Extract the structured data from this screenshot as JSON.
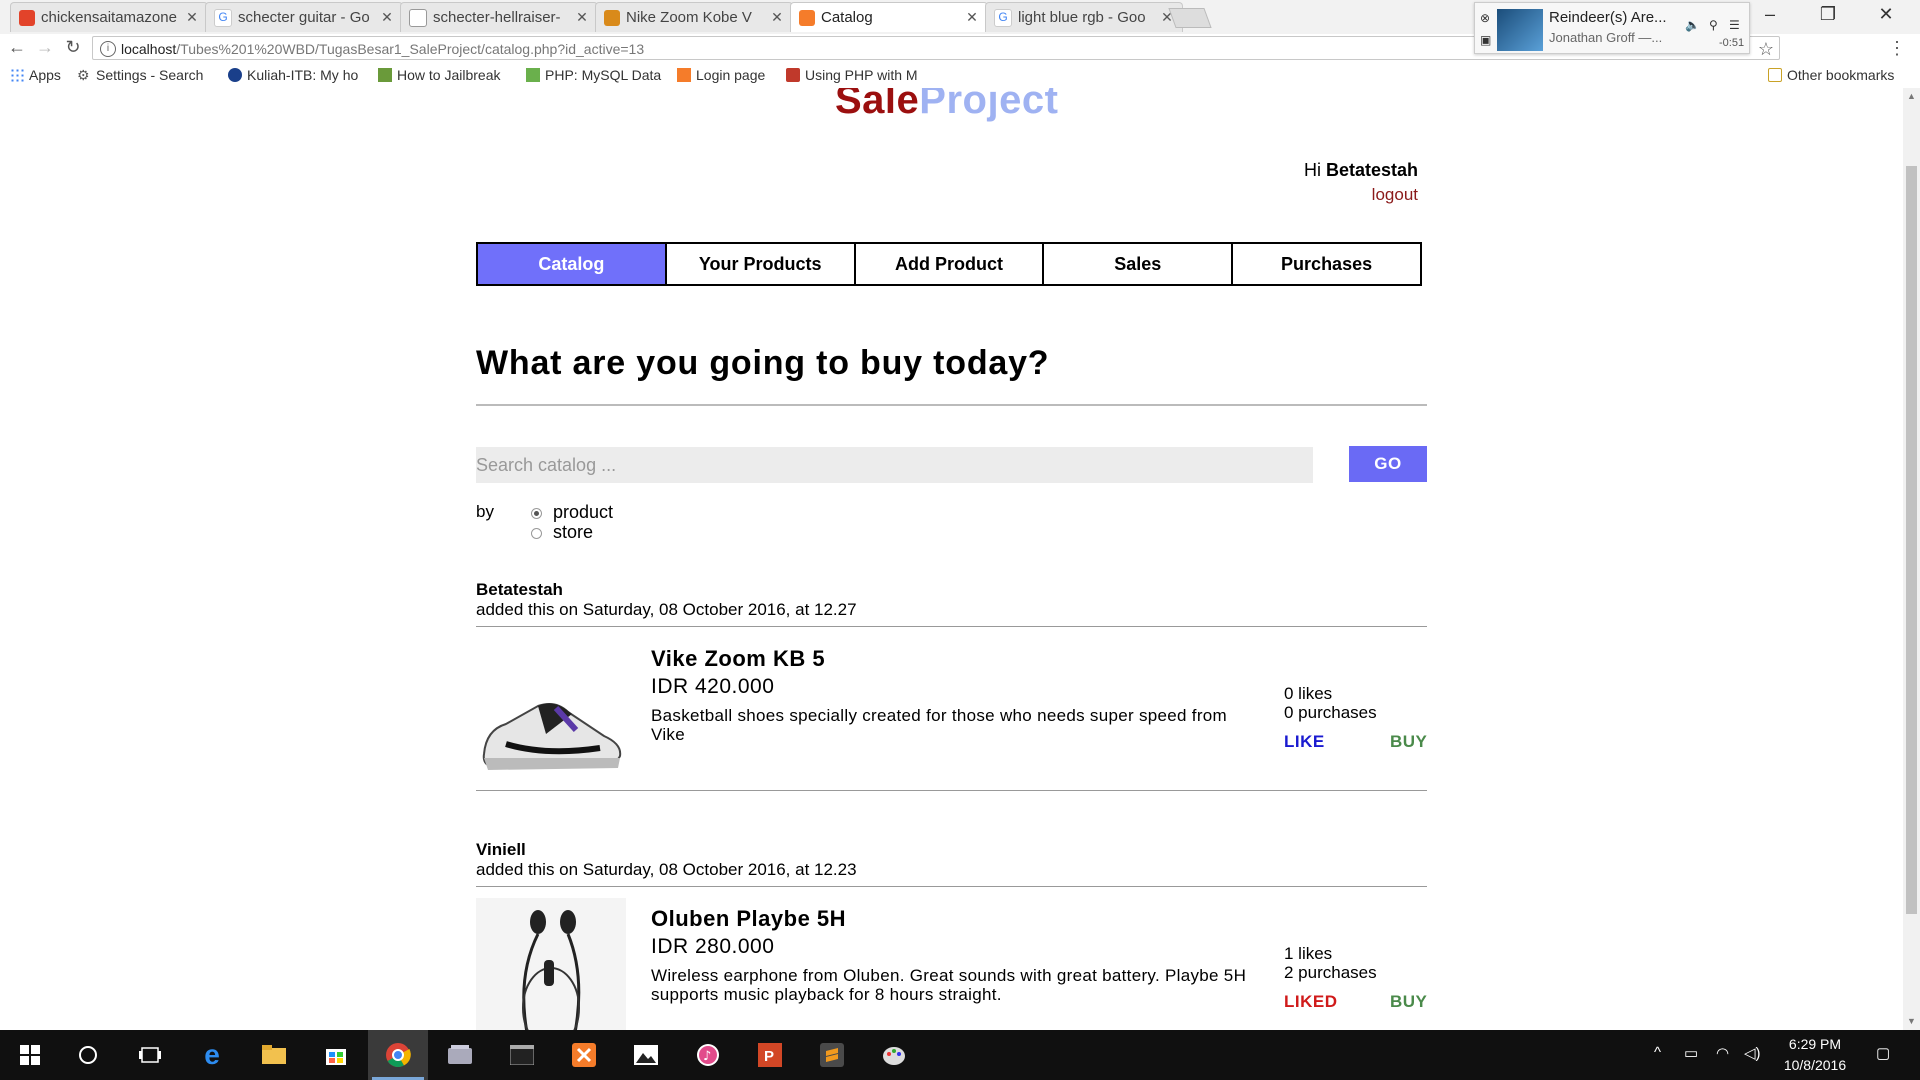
{
  "browser": {
    "tabs": [
      {
        "title": "chickensaitamazone",
        "favicon": "gitlab-icon",
        "active": false
      },
      {
        "title": "schecter guitar - Go",
        "favicon": "google-icon",
        "active": false
      },
      {
        "title": "schecter-hellraiser-",
        "favicon": "page-icon",
        "active": false
      },
      {
        "title": "Nike Zoom Kobe V",
        "favicon": "shoe-icon",
        "active": false
      },
      {
        "title": "Catalog",
        "favicon": "xampp-icon",
        "active": true
      },
      {
        "title": "light blue rgb - Goo",
        "favicon": "google-icon",
        "active": false
      }
    ],
    "url_host": "localhost",
    "url_path": "/Tubes%201%20WBD/TugasBesar1_SaleProject/catalog.php?id_active=13",
    "bookmarks": [
      {
        "label": "Apps",
        "icon": "apps-grid-icon"
      },
      {
        "label": "Settings - Search",
        "icon": "gear-icon"
      },
      {
        "label": "Kuliah-ITB: My ho",
        "icon": "itb-icon"
      },
      {
        "label": "How to Jailbreak",
        "icon": "page-icon"
      },
      {
        "label": "PHP: MySQL Data",
        "icon": "php-icon"
      },
      {
        "label": "Login page",
        "icon": "xampp-icon"
      },
      {
        "label": "Using PHP with M",
        "icon": "php-icon"
      }
    ],
    "other_bookmarks": "Other bookmarks"
  },
  "media": {
    "title": "Reindeer(s) Are...",
    "artist": "Jonathan Groff —...",
    "time": "-0:51"
  },
  "site": {
    "logo_part1": "Sale",
    "logo_part2": "Project",
    "greeting_prefix": "Hi",
    "username": "Betatestah",
    "logout": "logout",
    "nav": [
      "Catalog",
      "Your Products",
      "Add Product",
      "Sales",
      "Purchases"
    ],
    "active_nav": "Catalog",
    "headline": "What are you going to buy today?",
    "search_placeholder": "Search catalog ...",
    "go": "GO",
    "by": "by",
    "search_options": [
      "product",
      "store"
    ],
    "selected_option": "product"
  },
  "products": [
    {
      "seller": "Betatestah",
      "added": "added this on Saturday, 08 October 2016, at 12.27",
      "name": "Vike Zoom KB 5",
      "price": "IDR 420.000",
      "description": "Basketball shoes specially created for those who needs super speed from Vike",
      "likes": "0 likes",
      "purchases": "0 purchases",
      "like_label": "LIKE",
      "liked": false,
      "buy_label": "BUY"
    },
    {
      "seller": "Viniell",
      "added": "added this on Saturday, 08 October 2016, at 12.23",
      "name": "Oluben Playbe 5H",
      "price": "IDR 280.000",
      "description": "Wireless earphone from Oluben. Great sounds with great battery. Playbe 5H supports music playback for 8 hours straight.",
      "likes": "1 likes",
      "purchases": "2 purchases",
      "like_label": "LIKED",
      "liked": true,
      "buy_label": "BUY"
    }
  ],
  "taskbar": {
    "time": "6:29 PM",
    "date": "10/8/2016"
  },
  "colors": {
    "accent": "#7070fa",
    "logo_sale": "#9b0f0f",
    "logo_project": "#9fb2f2",
    "like": "#1a1ad0",
    "liked": "#d01a1a",
    "buy": "#4a8a4a"
  }
}
